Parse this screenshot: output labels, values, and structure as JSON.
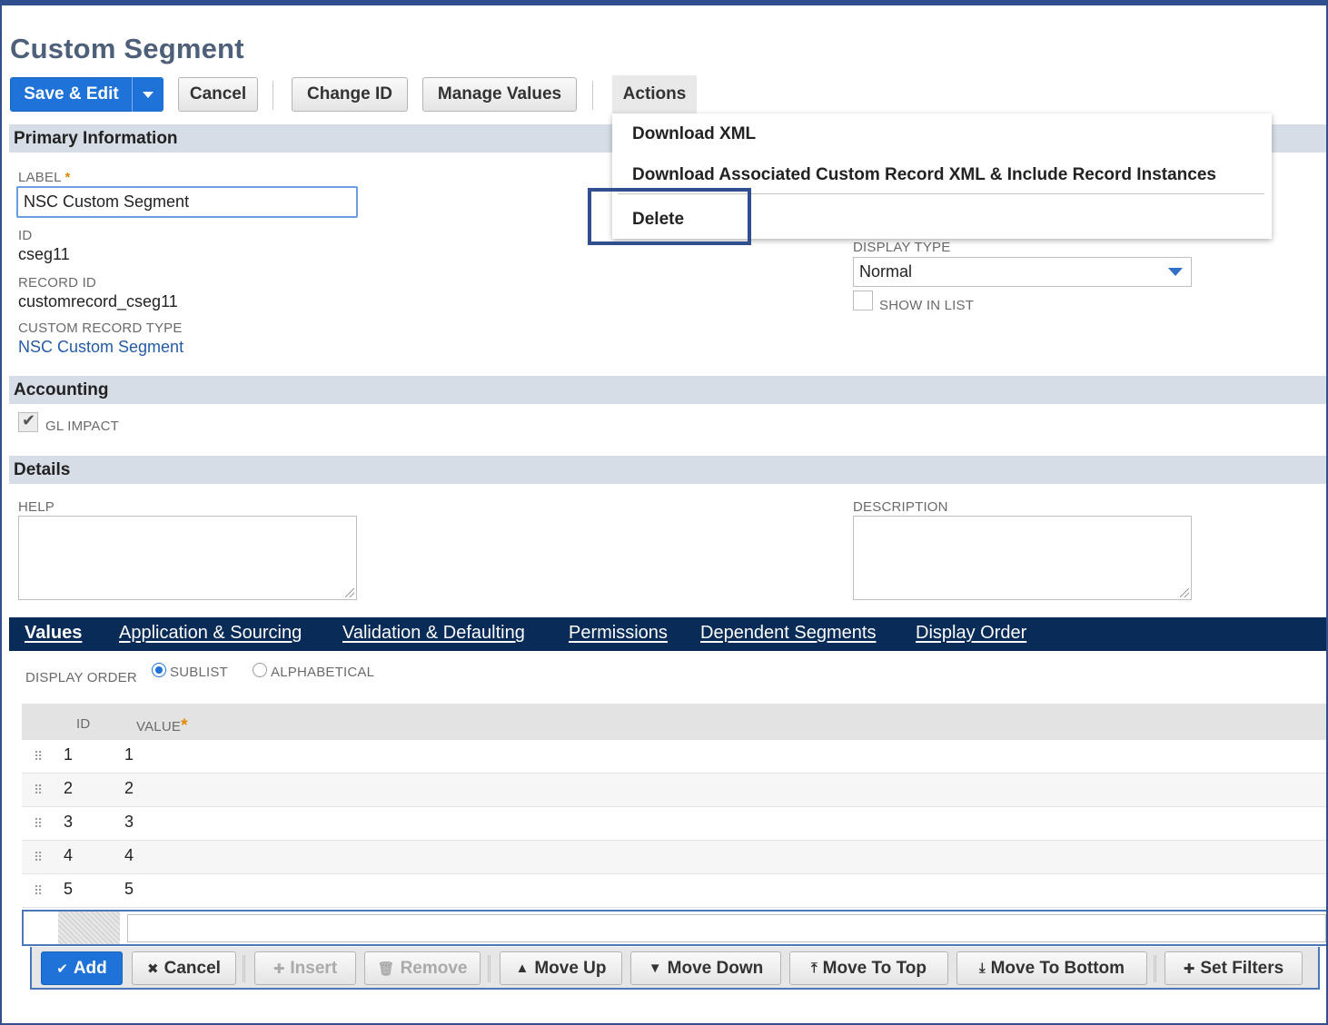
{
  "page": {
    "title": "Custom Segment"
  },
  "toolbar": {
    "save_edit": "Save & Edit",
    "cancel": "Cancel",
    "change_id": "Change ID",
    "manage_values": "Manage Values",
    "actions": "Actions"
  },
  "actions_menu": {
    "items": [
      "Download XML",
      "Download Associated Custom Record XML & Include Record Instances",
      "Delete"
    ]
  },
  "sections": {
    "primary": "Primary Information",
    "accounting": "Accounting",
    "details": "Details"
  },
  "primary": {
    "label_label": "LABEL",
    "label_value": "NSC Custom Segment",
    "id_label": "ID",
    "id_value": "cseg11",
    "record_id_label": "RECORD ID",
    "record_id_value": "customrecord_cseg11",
    "custom_record_type_label": "CUSTOM RECORD TYPE",
    "custom_record_type_value": "NSC Custom Segment",
    "display_type_label": "DISPLAY TYPE",
    "display_type_value": "Normal",
    "show_in_list_label": "SHOW IN LIST",
    "show_in_list_checked": false
  },
  "accounting": {
    "gl_impact_label": "GL IMPACT",
    "gl_impact_checked": true
  },
  "details": {
    "help_label": "HELP",
    "description_label": "DESCRIPTION"
  },
  "tabs": [
    "Values",
    "Application & Sourcing",
    "Validation & Defaulting",
    "Permissions",
    "Dependent Segments",
    "Display Order"
  ],
  "values": {
    "display_order_label": "DISPLAY ORDER",
    "options": [
      "SUBLIST",
      "ALPHABETICAL"
    ],
    "selected": "SUBLIST",
    "columns": [
      "ID",
      "VALUE"
    ],
    "rows": [
      {
        "id": "1",
        "value": "1"
      },
      {
        "id": "2",
        "value": "2"
      },
      {
        "id": "3",
        "value": "3"
      },
      {
        "id": "4",
        "value": "4"
      },
      {
        "id": "5",
        "value": "5"
      }
    ]
  },
  "sublist_buttons": {
    "add": "Add",
    "cancel": "Cancel",
    "insert": "Insert",
    "remove": "Remove",
    "move_up": "Move Up",
    "move_down": "Move Down",
    "move_to_top": "Move To Top",
    "move_to_bottom": "Move To Bottom",
    "set_filters": "Set Filters"
  },
  "colors": {
    "primary": "#1f73d8",
    "tabbar": "#082b57",
    "section": "#d6dde6",
    "required": "#e38b00"
  }
}
